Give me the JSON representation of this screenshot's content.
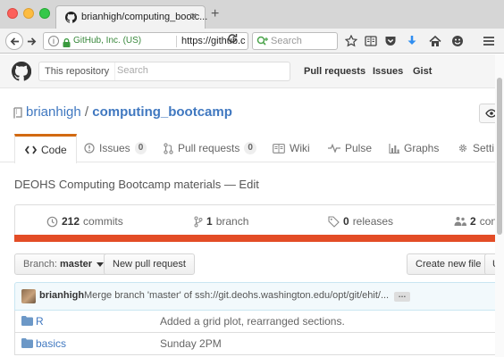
{
  "browser": {
    "tab_title": "brianhigh/computing_bootc...",
    "tab_close": "✕",
    "new_tab": "+",
    "identity": "GitHub, Inc. (US)",
    "url": "https://github.cc",
    "search_placeholder": "Search"
  },
  "header": {
    "scope_label": "This repository",
    "search_placeholder": "Search",
    "nav": [
      "Pull requests",
      "Issues",
      "Gist"
    ]
  },
  "repo": {
    "owner": "brianhigh",
    "separator": "/",
    "name": "computing_bootcamp",
    "description": "DEOHS Computing Bootcamp materials — Edit"
  },
  "tabs": {
    "code": "Code",
    "issues": "Issues",
    "issues_count": "0",
    "pulls": "Pull requests",
    "pulls_count": "0",
    "wiki": "Wiki",
    "pulse": "Pulse",
    "graphs": "Graphs",
    "settings": "Setti"
  },
  "summary": {
    "commits_count": "212",
    "commits_label": "commits",
    "branches_count": "1",
    "branches_label": "branch",
    "releases_count": "0",
    "releases_label": "releases",
    "contributors_count": "2",
    "contributors_label": "con",
    "language_color": "#e34c26"
  },
  "file_nav": {
    "branch_prefix": "Branch:",
    "branch": "master",
    "new_pr": "New pull request",
    "create_file": "Create new file",
    "upload": "U"
  },
  "commit": {
    "author": "brianhigh",
    "message": "Merge branch 'master' of ssh://git.deohs.washington.edu/opt/git/ehit/...",
    "ellipsis": "…"
  },
  "files": [
    {
      "name": "R",
      "message": "Added a grid plot, rearranged sections."
    },
    {
      "name": "basics",
      "message": "Sunday 2PM"
    }
  ],
  "colors": {
    "accent_tab": "#d26911",
    "link": "#4078c0"
  }
}
